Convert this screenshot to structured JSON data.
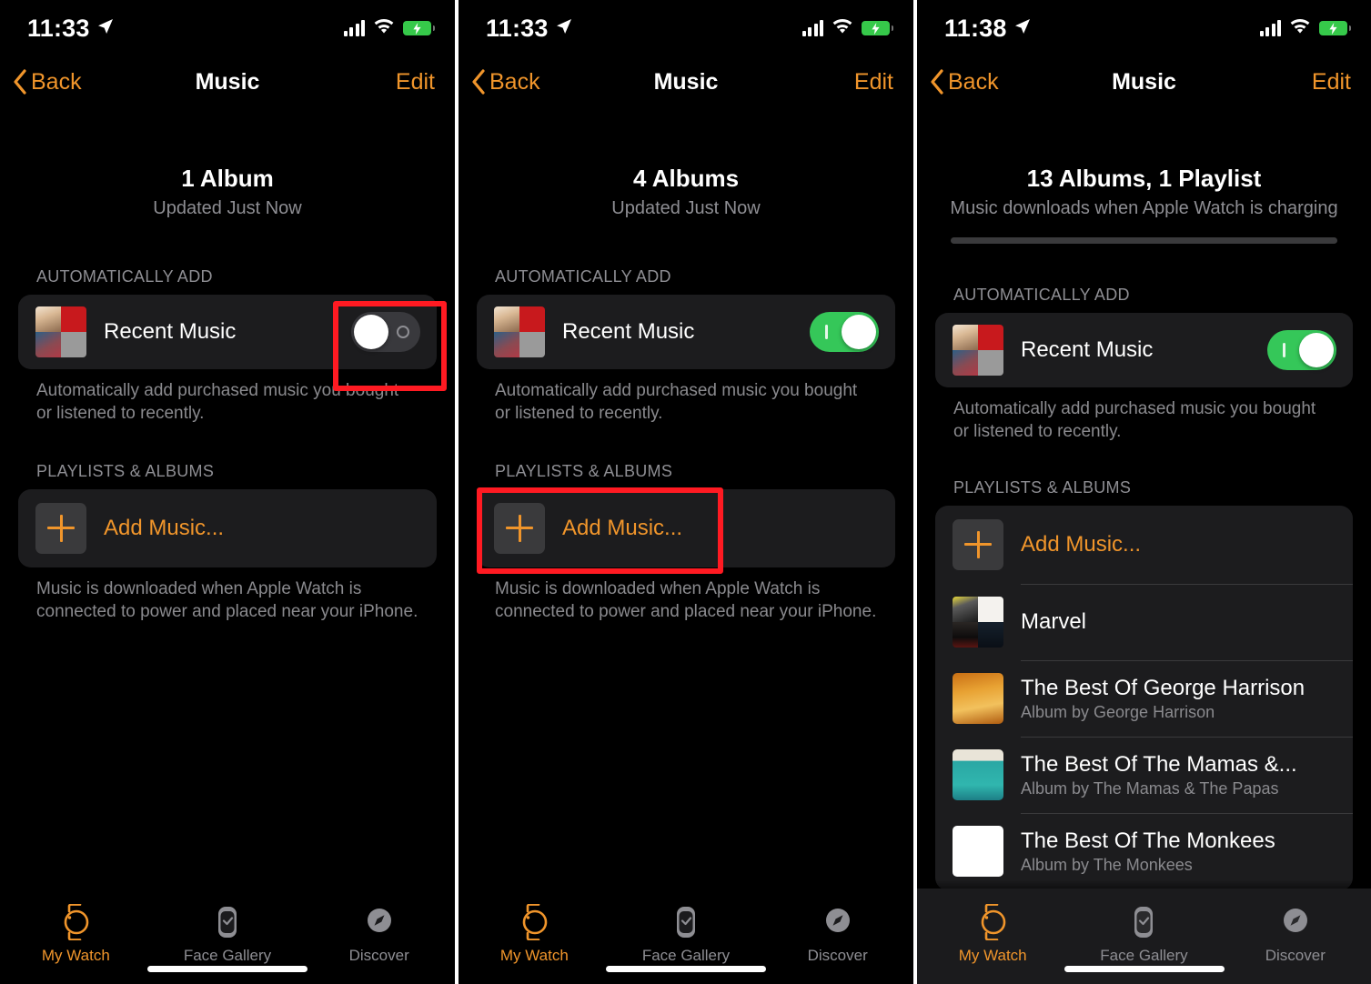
{
  "panels": [
    {
      "id": "panel-1",
      "status": {
        "time": "11:33",
        "location_icon": "location-arrow-icon",
        "cellular_icon": "cellular-bars-icon",
        "wifi_icon": "wifi-icon",
        "battery_icon": "battery-charging-icon"
      },
      "nav": {
        "back": "Back",
        "title": "Music",
        "edit": "Edit"
      },
      "summary": {
        "count": "1 Album",
        "sub": "Updated Just Now",
        "has_progress": false
      },
      "auto_section": {
        "header": "AUTOMATICALLY ADD",
        "row_label": "Recent Music",
        "toggle_state": "off",
        "footnote": "Automatically add purchased music you bought or listened to recently."
      },
      "playlists_section": {
        "header": "PLAYLISTS & ALBUMS",
        "add_label": "Add Music...",
        "footnote": "Music is downloaded when Apple Watch is connected to power and placed near your iPhone.",
        "items": []
      },
      "highlight": "toggle",
      "tabs": [
        {
          "label": "My Watch",
          "icon": "apple-watch-icon",
          "active": true
        },
        {
          "label": "Face Gallery",
          "icon": "watch-face-icon",
          "active": false
        },
        {
          "label": "Discover",
          "icon": "compass-icon",
          "active": false
        }
      ]
    },
    {
      "id": "panel-2",
      "status": {
        "time": "11:33",
        "location_icon": "location-arrow-icon",
        "cellular_icon": "cellular-bars-icon",
        "wifi_icon": "wifi-icon",
        "battery_icon": "battery-charging-icon"
      },
      "nav": {
        "back": "Back",
        "title": "Music",
        "edit": "Edit"
      },
      "summary": {
        "count": "4 Albums",
        "sub": "Updated Just Now",
        "has_progress": false
      },
      "auto_section": {
        "header": "AUTOMATICALLY ADD",
        "row_label": "Recent Music",
        "toggle_state": "on",
        "footnote": "Automatically add purchased music you bought or listened to recently."
      },
      "playlists_section": {
        "header": "PLAYLISTS & ALBUMS",
        "add_label": "Add Music...",
        "footnote": "Music is downloaded when Apple Watch is connected to power and placed near your iPhone.",
        "items": []
      },
      "highlight": "add-music",
      "tabs": [
        {
          "label": "My Watch",
          "icon": "apple-watch-icon",
          "active": true
        },
        {
          "label": "Face Gallery",
          "icon": "watch-face-icon",
          "active": false
        },
        {
          "label": "Discover",
          "icon": "compass-icon",
          "active": false
        }
      ]
    },
    {
      "id": "panel-3",
      "status": {
        "time": "11:38",
        "location_icon": "location-arrow-icon",
        "cellular_icon": "cellular-bars-icon",
        "wifi_icon": "wifi-icon",
        "battery_icon": "battery-charging-icon"
      },
      "nav": {
        "back": "Back",
        "title": "Music",
        "edit": "Edit"
      },
      "summary": {
        "count": "13 Albums, 1 Playlist",
        "sub": "Music downloads when Apple Watch is charging",
        "has_progress": true
      },
      "auto_section": {
        "header": "AUTOMATICALLY ADD",
        "row_label": "Recent Music",
        "toggle_state": "on",
        "footnote": "Automatically add purchased music you bought or listened to recently."
      },
      "playlists_section": {
        "header": "PLAYLISTS & ALBUMS",
        "add_label": "Add Music...",
        "footnote": "",
        "items": [
          {
            "title": "Marvel",
            "subtitle": "",
            "art": "mosaic-marvel"
          },
          {
            "title": "The Best Of George Harrison",
            "subtitle": "Album by George Harrison",
            "art": "art-george"
          },
          {
            "title": "The Best Of The Mamas &...",
            "subtitle": "Album by The Mamas & The Papas",
            "art": "art-mamas"
          },
          {
            "title": "The Best Of The Monkees",
            "subtitle": "Album by The Monkees",
            "art": "art-monkees"
          }
        ]
      },
      "highlight": "none",
      "tabs": [
        {
          "label": "My Watch",
          "icon": "apple-watch-icon",
          "active": true
        },
        {
          "label": "Face Gallery",
          "icon": "watch-face-icon",
          "active": false
        },
        {
          "label": "Discover",
          "icon": "compass-icon",
          "active": false
        }
      ]
    }
  ],
  "colors": {
    "accent": "#f0952b",
    "toggle_on": "#35c759",
    "toggle_off": "#39393d",
    "card": "#1c1c1e",
    "background": "#000000",
    "secondary_text": "#8e8e93",
    "highlight_box": "#ff1a22"
  }
}
